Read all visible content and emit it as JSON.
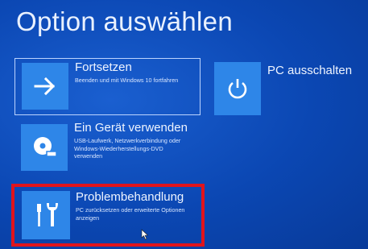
{
  "screen": {
    "title": "Option auswählen"
  },
  "options": {
    "continue": {
      "label": "Fortsetzen",
      "description": "Beenden und mit Windows 10 fortfahren",
      "icon": "arrow-right-icon"
    },
    "use_device": {
      "label": "Ein Gerät verwenden",
      "description": "USB-Laufwerk, Netzwerkverbindung oder Windows-Wiederherstellungs-DVD verwenden",
      "icon": "disc-drive-icon"
    },
    "troubleshoot": {
      "label": "Problembehandlung",
      "description": "PC zurücksetzen oder erweiterte Optionen anzeigen",
      "icon": "tools-icon"
    },
    "shutdown": {
      "label": "PC ausschalten",
      "icon": "power-icon"
    }
  },
  "colors": {
    "background": "#0b47b3",
    "tile_icon": "#2e86e8",
    "highlight": "#e0141c"
  }
}
